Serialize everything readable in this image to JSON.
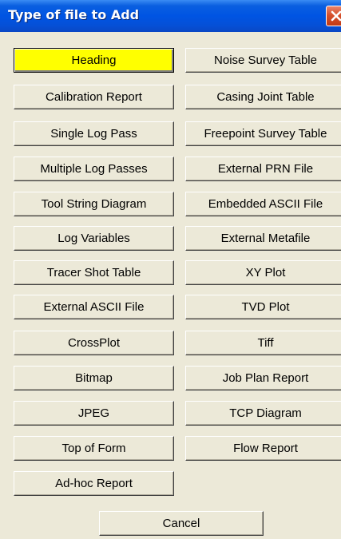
{
  "window": {
    "title": "Type of file to Add"
  },
  "left_column": [
    "Heading",
    "Calibration Report",
    "Single Log Pass",
    "Multiple Log Passes",
    "Tool String Diagram",
    "Log Variables",
    "Tracer Shot Table",
    "External ASCII File",
    "CrossPlot",
    "Bitmap",
    "JPEG",
    "Top of Form",
    "Ad-hoc Report"
  ],
  "right_column": [
    "Noise Survey Table",
    "Casing Joint Table",
    "Freepoint Survey Table",
    "External PRN File",
    "Embedded ASCII File",
    "External Metafile",
    "XY Plot",
    "TVD Plot",
    "Tiff",
    "Job Plan Report",
    "TCP Diagram",
    "Flow Report"
  ],
  "cancel_label": "Cancel",
  "colors": {
    "titlebar": "#0054e3",
    "dialog_bg": "#ece9d8",
    "selected_button": "#ffff00"
  }
}
